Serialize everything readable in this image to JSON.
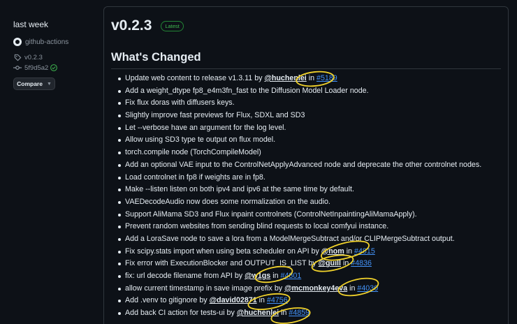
{
  "sidebar": {
    "when": "last week",
    "author": "github-actions",
    "tag": "v0.2.3",
    "commit": "5f9d5a2",
    "compare_label": "Compare"
  },
  "release": {
    "version": "v0.2.3",
    "badge": "Latest",
    "section_title": "What's Changed",
    "items": [
      {
        "text": "Update web content to release v1.3.11",
        "by": " by ",
        "user": "@huchenlei",
        "in": " in ",
        "pr": "#5189"
      },
      {
        "text": "Add a weight_dtype fp8_e4m3fn_fast to the Diffusion Model Loader node."
      },
      {
        "text": "Fix flux doras with diffusers keys."
      },
      {
        "text": "Slightly improve fast previews for Flux, SDXL and SD3"
      },
      {
        "text": "Let --verbose have an argument for the log level."
      },
      {
        "text": "Allow using SD3 type te output on flux model."
      },
      {
        "text": "torch.compile node (TorchCompileModel)"
      },
      {
        "text": "Add an optional VAE input to the ControlNetApplyAdvanced node and deprecate the other controlnet nodes."
      },
      {
        "text": "Load controlnet in fp8 if weights are in fp8."
      },
      {
        "text": "Make --listen listen on both ipv4 and ipv6 at the same time by default."
      },
      {
        "text": "VAEDecodeAudio now does some normalization on the audio."
      },
      {
        "text": "Support AliMama SD3 and Flux inpaint controlnets (ControlNetInpaintingAliMamaApply)."
      },
      {
        "text": "Prevent random websites from sending blind requests to local comfyui instance."
      },
      {
        "text": "Add a LoraSave node to save a lora from a ModelMergeSubtract and/or CLIPMergeSubtract output."
      },
      {
        "text": "Fix scipy.stats import when using beta scheduler on API",
        "by": " by ",
        "user": "@nom",
        "in": " in ",
        "pr": "#4815"
      },
      {
        "text": "Fix error with ExecutionBlocker and OUTPUT_IS_LIST",
        "by": " by ",
        "user": "@guill",
        "in": " in ",
        "pr": "#4836"
      },
      {
        "text": "fix: url decode filename from API",
        "by": " by ",
        "user": "@w1gs",
        "in": " in ",
        "pr": "#4801"
      },
      {
        "text": "allow current timestamp in save image prefix",
        "by": " by ",
        "user": "@mcmonkey4eva",
        "in": " in ",
        "pr": "#4030"
      },
      {
        "text": "Add .venv to gitignore",
        "by": " by ",
        "user": "@david02871",
        "in": " in ",
        "pr": "#4756"
      },
      {
        "text": "Add back CI action for tests-ui",
        "by": " by ",
        "user": "@huchenlei",
        "in": " in ",
        "pr": "#4859"
      }
    ]
  },
  "colors": {
    "background": "#0d1117",
    "text": "#e6edf3",
    "muted": "#8b949e",
    "link": "#4493f8",
    "badge_green": "#3fb950",
    "annotation_yellow": "#f2d32b"
  },
  "icons": [
    "github-mark-icon",
    "tag-icon",
    "commit-icon",
    "verified-check-icon",
    "caret-down-icon"
  ]
}
